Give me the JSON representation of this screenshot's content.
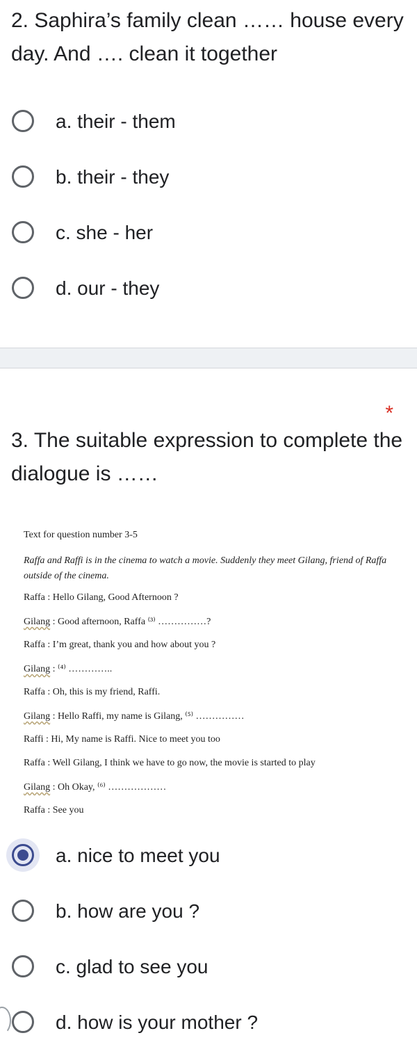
{
  "q2": {
    "text": "2. Saphira’s family clean …… house every day. And …. clean it together",
    "options": [
      {
        "label": "a. their - them",
        "selected": false
      },
      {
        "label": "b. their - they",
        "selected": false
      },
      {
        "label": "c. she - her",
        "selected": false
      },
      {
        "label": "d. our - they",
        "selected": false
      }
    ]
  },
  "q3": {
    "required_mark": "*",
    "text": "3.  The suitable expression to complete the dialogue is ……",
    "image": {
      "title": "Text for question number 3-5",
      "intro": "Raffa and Raffi is in the cinema to watch a movie. Suddenly they meet Gilang, friend of Raffa outside of the cinema.",
      "lines": [
        {
          "speaker": "Raffa",
          "text": ": Hello Gilang, Good Afternoon ?"
        },
        {
          "speaker": "Gilang",
          "text": ": Good afternoon, Raffa ⁽³⁾ ……………?"
        },
        {
          "speaker": "Raffa",
          "text": ": I’m great, thank you and how about you ?"
        },
        {
          "speaker": "Gilang",
          "text": ": ⁽⁴⁾ ………….."
        },
        {
          "speaker": "Raffa",
          "text": ": Oh, this is my friend, Raffi."
        },
        {
          "speaker": "Gilang",
          "text": ": Hello Raffi, my name is Gilang, ⁽⁵⁾ ……………"
        },
        {
          "speaker": "Raffi",
          "text": ": Hi, My name is Raffi. Nice to meet you too"
        },
        {
          "speaker": "Raffa",
          "text": ": Well Gilang, I think we have to go now, the movie is started to play"
        },
        {
          "speaker": "Gilang",
          "text": ": Oh Okay, ⁽⁶⁾ ………………"
        },
        {
          "speaker": "Raffa",
          "text": ": See you"
        }
      ]
    },
    "options": [
      {
        "label": "a. nice to meet you",
        "selected": true
      },
      {
        "label": "b. how are you ?",
        "selected": false
      },
      {
        "label": "c. glad to see you",
        "selected": false
      },
      {
        "label": "d. how is your mother ?",
        "selected": false
      }
    ]
  },
  "colors": {
    "accent": "#3c4b8f",
    "required": "#d93025",
    "divider": "#eef1f4"
  }
}
